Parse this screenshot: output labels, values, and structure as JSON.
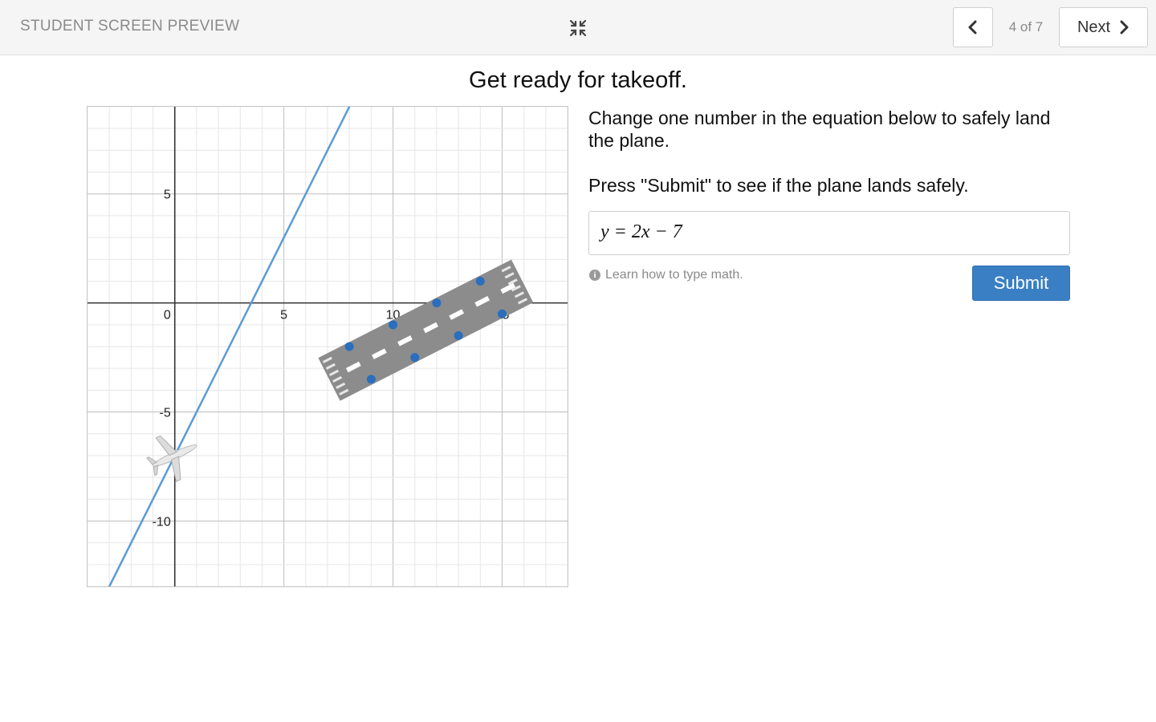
{
  "header": {
    "title": "STUDENT SCREEN PREVIEW",
    "collapse_icon": "collapse-arrows-icon",
    "prev_icon": "chevron-left-icon",
    "page_indicator": "4 of 7",
    "next_label": "Next",
    "next_icon": "chevron-right-icon"
  },
  "screen": {
    "title": "Get ready for takeoff.",
    "instructions": "Change one number in the equation below to safely land the plane.",
    "submit_hint": "Press \"Submit\" to see if the plane lands safely.",
    "equation": "y = 2x − 7",
    "help_text": "Learn how to type math.",
    "submit_label": "Submit"
  },
  "graph": {
    "x_range": [
      -4,
      18
    ],
    "y_range": [
      -13,
      9
    ],
    "tick_labels_x": [
      "5",
      "10",
      "15"
    ],
    "tick_labels_y": [
      "5",
      "-5",
      "-10"
    ],
    "origin_label": "0",
    "line": {
      "slope": 2,
      "intercept": -7,
      "color": "#5b9bd5"
    },
    "plane_position": {
      "x": 0,
      "y": -7
    },
    "runway_points": [
      {
        "x": 8,
        "y": -2
      },
      {
        "x": 9,
        "y": -3.5
      },
      {
        "x": 10,
        "y": -1
      },
      {
        "x": 11,
        "y": -2.5
      },
      {
        "x": 12,
        "y": 0
      },
      {
        "x": 13,
        "y": -1.5
      },
      {
        "x": 14,
        "y": 1
      },
      {
        "x": 15,
        "y": -0.5
      }
    ],
    "point_color": "#2a6ebd",
    "runway_color": "#8c8c8c"
  },
  "colors": {
    "accent": "#3a7fc4",
    "header_bg": "#f5f5f5",
    "muted_text": "#8a8a8a"
  }
}
